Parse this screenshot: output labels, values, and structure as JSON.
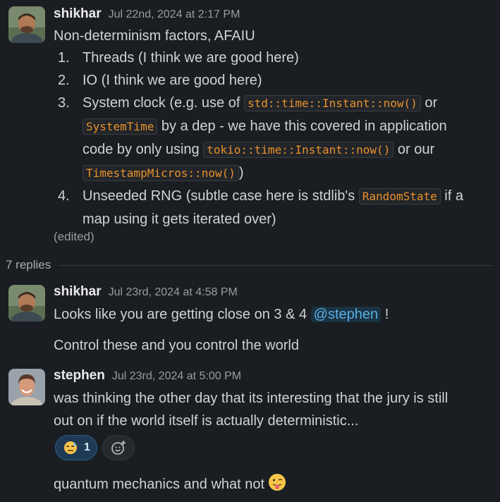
{
  "messages": [
    {
      "author": "shikhar",
      "timestamp": "Jul 22nd, 2024 at 2:17 PM",
      "intro": "Non-determinism factors, AFAIU",
      "list": [
        {
          "num": "1.",
          "text": "Threads (I think we are good here)"
        },
        {
          "num": "2.",
          "text": "IO (I think we are good here)"
        },
        {
          "num": "3.",
          "t1": "System clock (e.g. use of ",
          "c1": "std::time::Instant::now()",
          "t2": " or",
          "c2": "SystemTime",
          "t3": " by a dep - we have this covered in application",
          "t4": "code by only using ",
          "c3": "tokio::time::Instant::now()",
          "t5": " or our",
          "c4": "TimestampMicros::now()",
          "t6": ")"
        },
        {
          "num": "4.",
          "t1": "Unseeded RNG (subtle case here is stdlib's ",
          "c1": "RandomState",
          "t2": " if a",
          "t3": "map using it gets iterated over)"
        }
      ],
      "edited": "(edited)"
    }
  ],
  "thread": {
    "replies_label": "7 replies",
    "replies": [
      {
        "author": "shikhar",
        "timestamp": "Jul 23rd, 2024 at 4:58 PM",
        "line1_prefix": "Looks like you are getting close on 3 & 4 ",
        "mention": "@stephen",
        "line1_suffix": " !",
        "line2": "Control these and you control the world"
      },
      {
        "author": "stephen",
        "timestamp": "Jul 23rd, 2024 at 5:00 PM",
        "line1": "was thinking the other day that its interesting that the jury is still",
        "line2": "out on if the world itself is actually deterministic...",
        "reaction": {
          "icon": "thinking-sweat-emoji",
          "count": "1"
        },
        "add_reaction_icon": "add-reaction-icon"
      },
      {
        "line": "quantum mechanics and what not",
        "emoji": "tongue-out-emoji"
      }
    ]
  },
  "colors": {
    "background": "#1a1d21",
    "code_text": "#e8912d",
    "mention": "#58aee6",
    "reaction_bg": "#1f3a54"
  }
}
